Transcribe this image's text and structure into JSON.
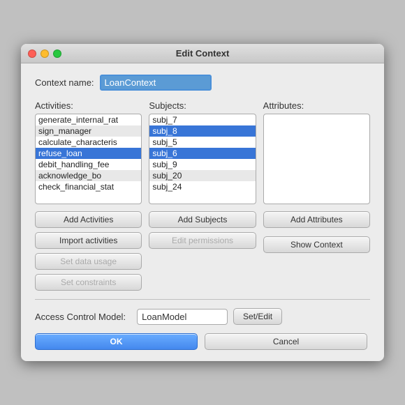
{
  "window": {
    "title": "Edit Context"
  },
  "context_name": {
    "label": "Context name:",
    "value": "LoanContext",
    "placeholder": "LoanContext"
  },
  "activities": {
    "label": "Activities:",
    "items": [
      {
        "text": "generate_internal_rat",
        "selected": false,
        "alt": false
      },
      {
        "text": "sign_manager",
        "selected": false,
        "alt": true
      },
      {
        "text": "calculate_characteris",
        "selected": false,
        "alt": false
      },
      {
        "text": "refuse_loan",
        "selected": true,
        "alt": false
      },
      {
        "text": "debit_handling_fee",
        "selected": false,
        "alt": false
      },
      {
        "text": "acknowledge_bo",
        "selected": false,
        "alt": true
      },
      {
        "text": "check_financial_stat",
        "selected": false,
        "alt": false
      }
    ]
  },
  "subjects": {
    "label": "Subjects:",
    "items": [
      {
        "text": "subj_7",
        "selected": false,
        "alt": false
      },
      {
        "text": "subj_8",
        "selected": true,
        "alt": false
      },
      {
        "text": "subj_5",
        "selected": false,
        "alt": false
      },
      {
        "text": "subj_6",
        "selected": true,
        "alt": false
      },
      {
        "text": "subj_9",
        "selected": false,
        "alt": false
      },
      {
        "text": "subj_20",
        "selected": false,
        "alt": true
      },
      {
        "text": "subj_24",
        "selected": false,
        "alt": false
      }
    ]
  },
  "attributes": {
    "label": "Attributes:",
    "items": []
  },
  "buttons": {
    "add_activities": "Add Activities",
    "import_activities": "Import activities",
    "set_data_usage": "Set data usage",
    "set_constraints": "Set constraints",
    "add_subjects": "Add Subjects",
    "edit_permissions": "Edit permissions",
    "add_attributes": "Add Attributes",
    "show_context": "Show Context"
  },
  "access_control": {
    "label": "Access Control Model:",
    "value": "LoanModel",
    "set_edit_label": "Set/Edit"
  },
  "footer": {
    "ok_label": "OK",
    "cancel_label": "Cancel"
  }
}
